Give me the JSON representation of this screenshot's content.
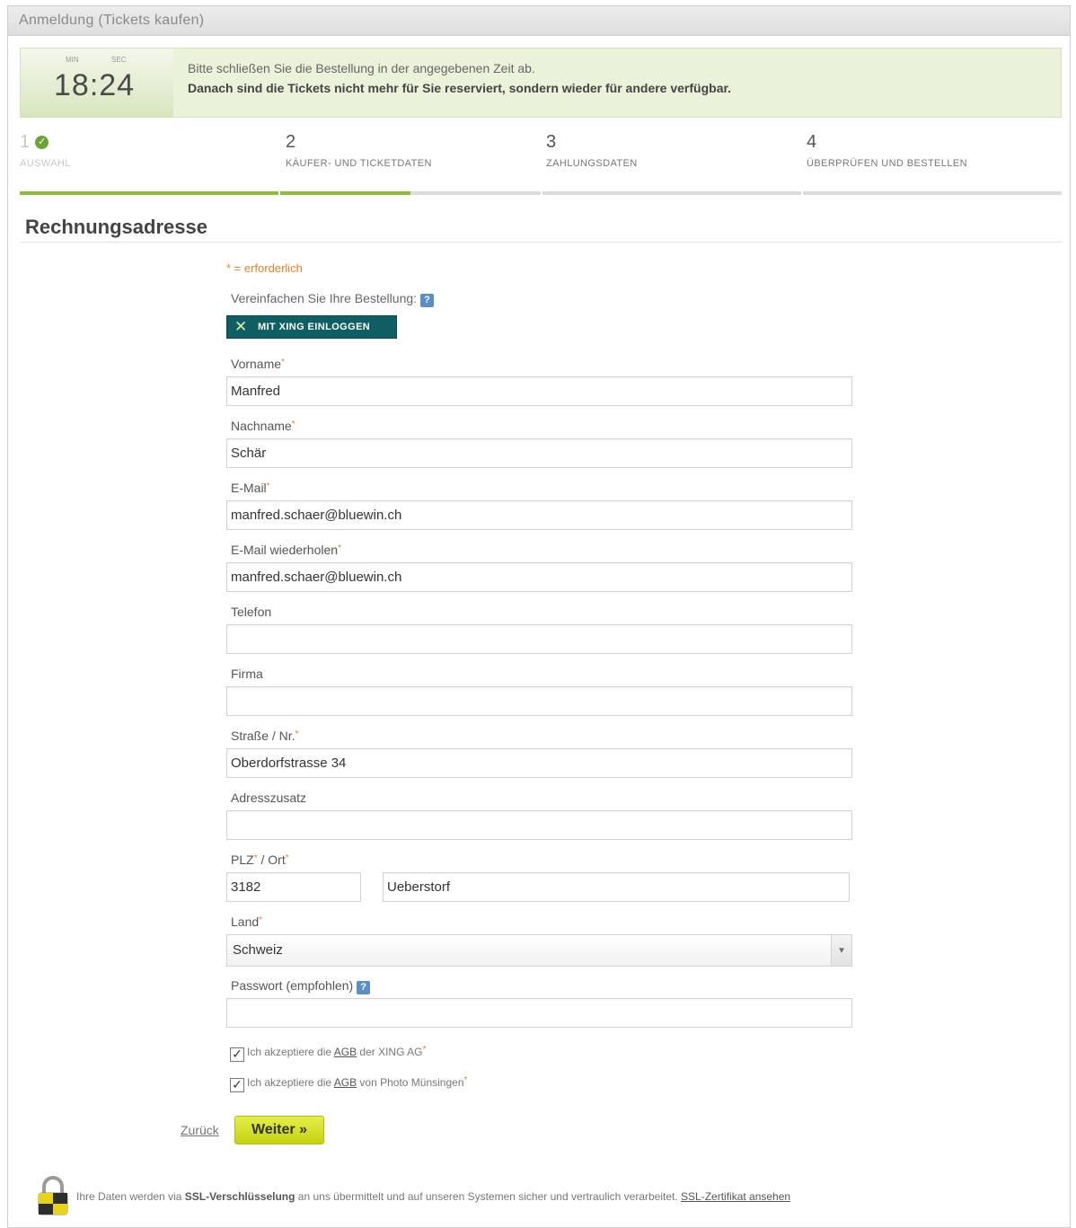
{
  "window": {
    "title": "Anmeldung (Tickets kaufen)"
  },
  "timer": {
    "min_label": "MIN",
    "sec_label": "SEC",
    "time": "18:24",
    "message_line1": "Bitte schließen Sie die Bestellung in der angegebenen Zeit ab.",
    "message_line2": "Danach sind die Tickets nicht mehr für Sie reserviert, sondern wieder für andere verfügbar."
  },
  "steps": [
    {
      "number": "1",
      "label": "AUSWAHL",
      "state": "done"
    },
    {
      "number": "2",
      "label": "KÄUFER- UND TICKETDATEN",
      "state": "current"
    },
    {
      "number": "3",
      "label": "ZAHLUNGSDATEN",
      "state": "todo"
    },
    {
      "number": "4",
      "label": "ÜBERPRÜFEN UND BESTELLEN",
      "state": "todo"
    }
  ],
  "progress_fraction": 0.375,
  "section": {
    "title": "Rechnungsadresse"
  },
  "form": {
    "required_note": "* = erforderlich",
    "simplify_label": "Vereinfachen Sie Ihre Bestellung:",
    "help_icon": "?",
    "xing_button": "MIT XING EINLOGGEN",
    "fields": {
      "vorname": {
        "label": "Vorname",
        "required": "*",
        "value": "Manfred"
      },
      "nachname": {
        "label": "Nachname",
        "required": "*",
        "value": "Schär"
      },
      "email": {
        "label": "E-Mail",
        "required": "*",
        "value": "manfred.schaer@bluewin.ch"
      },
      "email_repeat": {
        "label": "E-Mail wiederholen",
        "required": "*",
        "value": "manfred.schaer@bluewin.ch"
      },
      "telefon": {
        "label": "Telefon",
        "value": ""
      },
      "firma": {
        "label": "Firma",
        "value": ""
      },
      "strasse": {
        "label": "Straße / Nr.",
        "required": "*",
        "value": "Oberdorfstrasse 34"
      },
      "adresszusatz": {
        "label": "Adresszusatz",
        "value": ""
      },
      "plz_ort": {
        "label_plz": "PLZ",
        "label_sep": " / Ort",
        "required": "*",
        "plz_value": "3182",
        "ort_value": "Ueberstorf"
      },
      "land": {
        "label": "Land",
        "required": "*",
        "value": "Schweiz"
      },
      "passwort": {
        "label": "Passwort (empfohlen)",
        "value": ""
      }
    },
    "checkbox1": {
      "prefix": "Ich akzeptiere die ",
      "link": "AGB",
      "suffix": " der XING AG",
      "required": "*",
      "checked": true
    },
    "checkbox2": {
      "prefix": "Ich akzeptiere die ",
      "link": "AGB",
      "suffix": " von Photo Münsingen",
      "required": "*",
      "checked": true
    },
    "back_link": "Zurück",
    "next_button": "Weiter »"
  },
  "ssl": {
    "prefix": "Ihre Daten werden via ",
    "bold": "SSL-Verschlüsselung",
    "suffix": " an uns übermittelt und auf unseren Systemen sicher und vertraulich verarbeitet. ",
    "link": "SSL-Zertifikat ansehen"
  }
}
